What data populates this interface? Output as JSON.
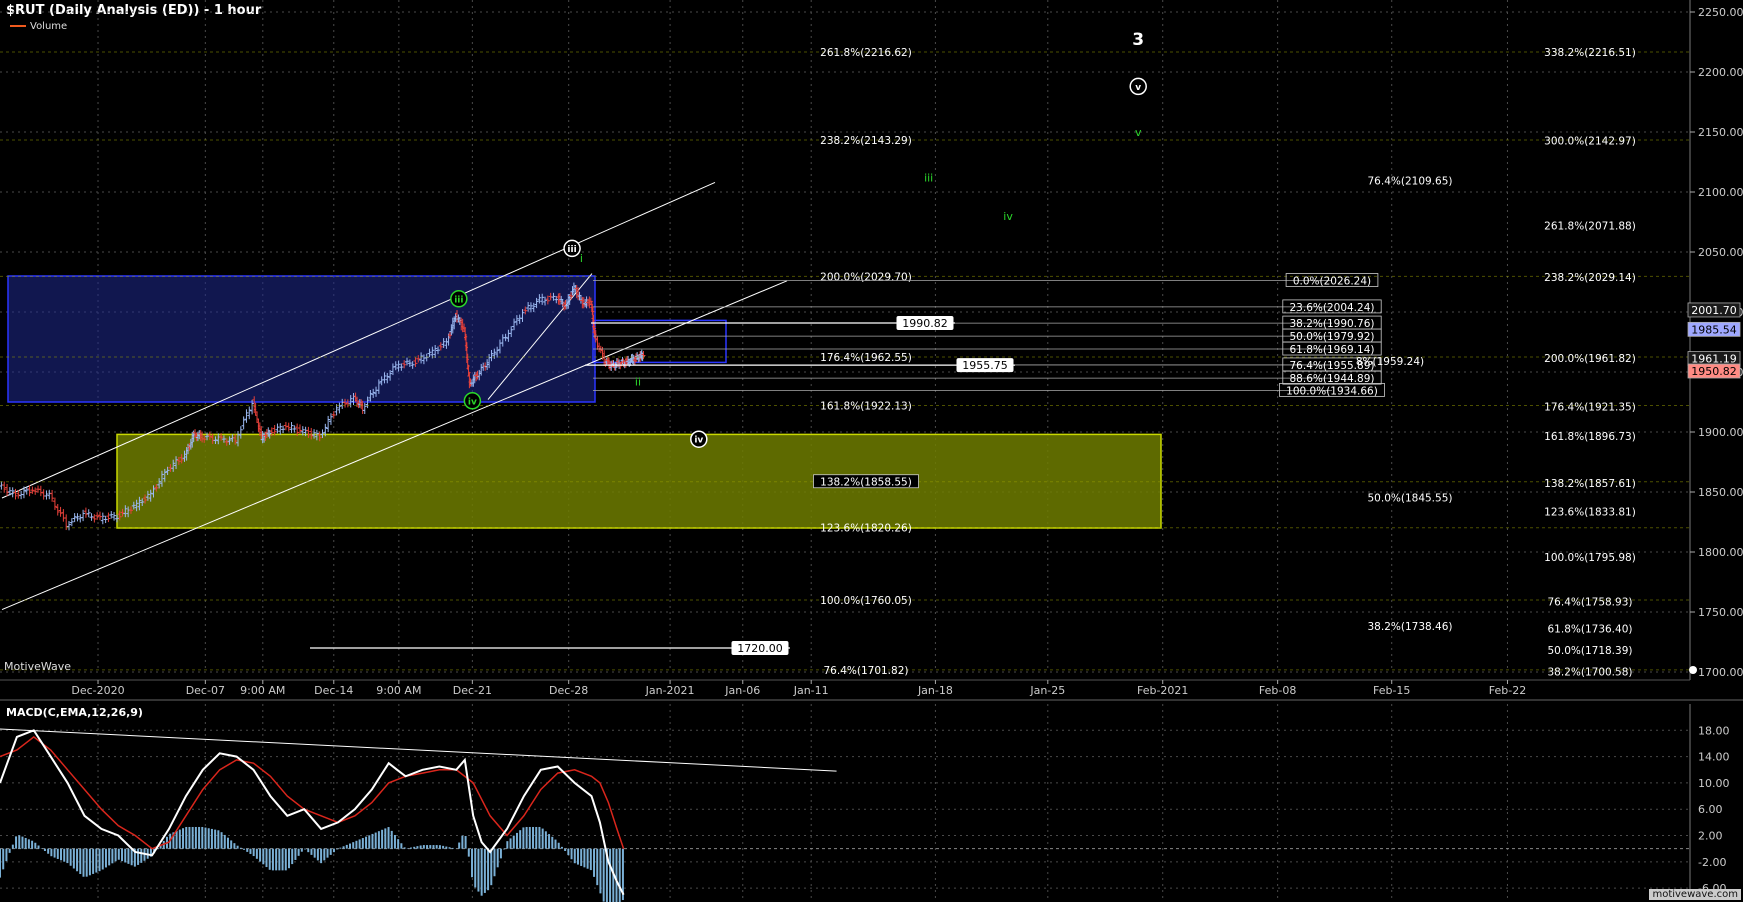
{
  "header": {
    "title": "$RUT (Daily Analysis (ED)) - 1 hour",
    "legend_volume": "Volume",
    "watermark": "MotiveWave",
    "macd_title": "MACD(C,EMA,12,26,9)",
    "logo": "motivewave.com"
  },
  "colors": {
    "background": "#000000",
    "grid": "#4a4a4a",
    "up_bar": "#9bb8f0",
    "down_bar": "#e8413a",
    "blue_box": "#1f2a8f",
    "yellow_box": "#6f7d00",
    "macd_line": "#ffffff",
    "signal_line": "#d9261c",
    "histogram": "#7ab0d6",
    "wave_green": "#2bd82b"
  },
  "chart_data": {
    "type": "candlestick",
    "price_axis": {
      "ylim": [
        1700,
        2260
      ],
      "ticks": [
        "2250.00",
        "2200.00",
        "2150.00",
        "2100.00",
        "2050.00",
        "2000.00",
        "1950.00",
        "1900.00",
        "1850.00",
        "1800.00",
        "1750.00",
        "1700.00"
      ],
      "tick_values": [
        2250,
        2200,
        2150,
        2100,
        2050,
        2000,
        1950,
        1900,
        1850,
        1800,
        1750,
        1700
      ],
      "price_tags": [
        {
          "label": "2001.70",
          "value": 2001.7,
          "style": "dark"
        },
        {
          "label": "1985.54",
          "value": 1985.54,
          "style": "light"
        },
        {
          "label": "1961.19",
          "value": 1961.19,
          "style": "dark"
        },
        {
          "label": "1950.82",
          "value": 1950.82,
          "style": "red"
        }
      ]
    },
    "time_axis": {
      "labels": [
        "Dec-2020",
        "Dec-07",
        "9:00 AM",
        "Dec-14",
        "9:00 AM",
        "Dec-21",
        "Dec-28",
        "Jan-2021",
        "Jan-06",
        "Jan-11",
        "Jan-18",
        "Jan-25",
        "Feb-2021",
        "Feb-08",
        "Feb-15",
        "Feb-22"
      ],
      "positions": [
        0.058,
        0.1215,
        0.1555,
        0.1975,
        0.236,
        0.2795,
        0.3365,
        0.3965,
        0.4395,
        0.48,
        0.5535,
        0.62,
        0.688,
        0.756,
        0.8235,
        0.892
      ]
    },
    "price_path": [
      [
        0,
        1855
      ],
      [
        0.01,
        1848
      ],
      [
        0.02,
        1852
      ],
      [
        0.03,
        1847
      ],
      [
        0.04,
        1823
      ],
      [
        0.05,
        1832
      ],
      [
        0.06,
        1828
      ],
      [
        0.07,
        1830
      ],
      [
        0.08,
        1838
      ],
      [
        0.09,
        1848
      ],
      [
        0.1,
        1870
      ],
      [
        0.11,
        1880
      ],
      [
        0.115,
        1898
      ],
      [
        0.12,
        1896
      ],
      [
        0.13,
        1894
      ],
      [
        0.14,
        1893
      ],
      [
        0.15,
        1925
      ],
      [
        0.155,
        1895
      ],
      [
        0.16,
        1900
      ],
      [
        0.17,
        1905
      ],
      [
        0.18,
        1900
      ],
      [
        0.19,
        1897
      ],
      [
        0.2,
        1920
      ],
      [
        0.21,
        1928
      ],
      [
        0.215,
        1920
      ],
      [
        0.225,
        1940
      ],
      [
        0.235,
        1955
      ],
      [
        0.245,
        1958
      ],
      [
        0.255,
        1965
      ],
      [
        0.265,
        1975
      ],
      [
        0.27,
        1998
      ],
      [
        0.275,
        1985
      ],
      [
        0.278,
        1940
      ],
      [
        0.283,
        1948
      ],
      [
        0.29,
        1960
      ],
      [
        0.3,
        1980
      ],
      [
        0.31,
        2000
      ],
      [
        0.32,
        2010
      ],
      [
        0.33,
        2012
      ],
      [
        0.335,
        2005
      ],
      [
        0.34,
        2020
      ],
      [
        0.345,
        2008
      ],
      [
        0.35,
        2008
      ],
      [
        0.352,
        1980
      ],
      [
        0.358,
        1960
      ],
      [
        0.362,
        1955
      ],
      [
        0.366,
        1957
      ],
      [
        0.37,
        1958
      ],
      [
        0.374,
        1960
      ],
      [
        0.378,
        1962
      ],
      [
        0.381,
        1965
      ]
    ],
    "fib_labels": [
      {
        "label": "261.8%(2216.62)",
        "value": 2216.62,
        "col": "a"
      },
      {
        "label": "238.2%(2143.29)",
        "value": 2143.29,
        "col": "a"
      },
      {
        "label": "200.0%(2029.70)",
        "value": 2029.7,
        "col": "a"
      },
      {
        "label": "176.4%(1962.55)",
        "value": 1962.55,
        "col": "a"
      },
      {
        "label": "161.8%(1922.13)",
        "value": 1922.13,
        "col": "a"
      },
      {
        "label": "138.2%(1858.55)",
        "value": 1858.55,
        "col": "a"
      },
      {
        "label": "123.6%(1820.26)",
        "value": 1820.26,
        "col": "a"
      },
      {
        "label": "100.0%(1760.05)",
        "value": 1760.05,
        "col": "a"
      },
      {
        "label": "76.4%(1701.82)",
        "value": 1701.82,
        "col": "a"
      },
      {
        "label": "76.4%(2109.65)",
        "value": 2109.65,
        "col": "b"
      },
      {
        "label": "50.0%(1845.55)",
        "value": 1845.55,
        "col": "b"
      },
      {
        "label": "38.2%(1738.46)",
        "value": 1738.46,
        "col": "b"
      },
      {
        "label": "0.0%(2026.24)",
        "value": 2026.24,
        "col": "c"
      },
      {
        "label": "23.6%(2004.24)",
        "value": 2004.24,
        "col": "c"
      },
      {
        "label": "38.2%(1990.76)",
        "value": 1990.76,
        "col": "c"
      },
      {
        "label": "50.0%(1979.92)",
        "value": 1979.92,
        "col": "c"
      },
      {
        "label": "61.8%(1969.14)",
        "value": 1969.14,
        "col": "c"
      },
      {
        "label": "76.4%(1955.89)",
        "value": 1955.89,
        "col": "c"
      },
      {
        "label": "88.6%(1944.89)",
        "value": 1944.89,
        "col": "c"
      },
      {
        "label": "100.0%(1934.66)",
        "value": 1934.66,
        "col": "c"
      },
      {
        "label": "8%(1959.24)",
        "value": 1959.24,
        "col": "d"
      },
      {
        "label": "338.2%(2216.51)",
        "value": 2216.51,
        "col": "e"
      },
      {
        "label": "300.0%(2142.97)",
        "value": 2142.97,
        "col": "e"
      },
      {
        "label": "261.8%(2071.88)",
        "value": 2071.88,
        "col": "e"
      },
      {
        "label": "238.2%(2029.14)",
        "value": 2029.14,
        "col": "e"
      },
      {
        "label": "200.0%(1961.82)",
        "value": 1961.82,
        "col": "e"
      },
      {
        "label": "176.4%(1921.35)",
        "value": 1921.35,
        "col": "e"
      },
      {
        "label": "161.8%(1896.73)",
        "value": 1896.73,
        "col": "e"
      },
      {
        "label": "138.2%(1857.61)",
        "value": 1857.61,
        "col": "e"
      },
      {
        "label": "123.6%(1833.81)",
        "value": 1833.81,
        "col": "e"
      },
      {
        "label": "100.0%(1795.98)",
        "value": 1795.98,
        "col": "e"
      },
      {
        "label": "76.4%(1758.93)",
        "value": 1758.93,
        "col": "e"
      },
      {
        "label": "61.8%(1736.40)",
        "value": 1736.4,
        "col": "e"
      },
      {
        "label": "50.0%(1718.39)",
        "value": 1718.39,
        "col": "e"
      },
      {
        "label": "38.2%(1700.58)",
        "value": 1700.58,
        "col": "e"
      }
    ],
    "price_lines": [
      {
        "label": "1990.82",
        "value": 1990.82
      },
      {
        "label": "1955.75",
        "value": 1955.75
      },
      {
        "label": "1720.00",
        "value": 1720.0
      }
    ],
    "wave_labels": [
      {
        "label": "3",
        "style": "plain",
        "color": "white",
        "t": 0.6735,
        "value": 2226
      },
      {
        "label": "v",
        "style": "circle",
        "color": "white",
        "t": 0.6735,
        "value": 2188
      },
      {
        "label": "v",
        "style": "plain",
        "color": "green",
        "t": 0.6735,
        "value": 2150
      },
      {
        "label": "iii",
        "style": "plain",
        "color": "green",
        "t": 0.5495,
        "value": 2112
      },
      {
        "label": "iv",
        "style": "plain",
        "color": "green",
        "t": 0.5965,
        "value": 2080
      },
      {
        "label": "iii",
        "style": "circle",
        "color": "white",
        "t": 0.3385,
        "value": 2053
      },
      {
        "label": "i",
        "style": "plain",
        "color": "green",
        "t": 0.344,
        "value": 2045
      },
      {
        "label": "iii",
        "style": "circle",
        "color": "green",
        "t": 0.2715,
        "value": 2011
      },
      {
        "label": "iv",
        "style": "circle",
        "color": "green",
        "t": 0.2795,
        "value": 1926
      },
      {
        "label": "iv",
        "style": "circle",
        "color": "white",
        "t": 0.4135,
        "value": 1894
      },
      {
        "label": "ii",
        "style": "plain",
        "color": "green",
        "t": 0.3775,
        "value": 1942
      }
    ],
    "macd": {
      "ylim": [
        -7.5,
        22
      ],
      "ticks": [
        "18.00",
        "14.00",
        "10.00",
        "6.00",
        "2.00",
        "-2.00",
        "-6.00"
      ],
      "tick_values": [
        18,
        14,
        10,
        6,
        2,
        -2,
        -6
      ],
      "macd_line": [
        [
          0,
          10
        ],
        [
          0.01,
          17
        ],
        [
          0.02,
          18
        ],
        [
          0.03,
          14
        ],
        [
          0.04,
          10
        ],
        [
          0.05,
          5
        ],
        [
          0.06,
          3
        ],
        [
          0.07,
          2
        ],
        [
          0.08,
          -0.5
        ],
        [
          0.09,
          -1
        ],
        [
          0.1,
          3
        ],
        [
          0.11,
          8
        ],
        [
          0.12,
          12
        ],
        [
          0.13,
          14.5
        ],
        [
          0.14,
          14
        ],
        [
          0.15,
          12
        ],
        [
          0.16,
          8
        ],
        [
          0.17,
          5
        ],
        [
          0.18,
          6
        ],
        [
          0.19,
          3
        ],
        [
          0.2,
          4
        ],
        [
          0.21,
          6
        ],
        [
          0.22,
          9
        ],
        [
          0.23,
          13
        ],
        [
          0.235,
          12
        ],
        [
          0.24,
          11
        ],
        [
          0.25,
          12
        ],
        [
          0.26,
          12.5
        ],
        [
          0.27,
          12
        ],
        [
          0.275,
          13.5
        ],
        [
          0.28,
          5
        ],
        [
          0.285,
          1
        ],
        [
          0.29,
          -0.5
        ],
        [
          0.3,
          3
        ],
        [
          0.31,
          8
        ],
        [
          0.32,
          12
        ],
        [
          0.33,
          12.5
        ],
        [
          0.34,
          10
        ],
        [
          0.35,
          8
        ],
        [
          0.355,
          4
        ],
        [
          0.36,
          -2
        ],
        [
          0.365,
          -5
        ],
        [
          0.369,
          -7
        ]
      ],
      "signal_line": [
        [
          0,
          14
        ],
        [
          0.01,
          15
        ],
        [
          0.02,
          17
        ],
        [
          0.03,
          15
        ],
        [
          0.04,
          12
        ],
        [
          0.05,
          9
        ],
        [
          0.06,
          6
        ],
        [
          0.07,
          3.5
        ],
        [
          0.08,
          2
        ],
        [
          0.09,
          0
        ],
        [
          0.1,
          1
        ],
        [
          0.11,
          5
        ],
        [
          0.12,
          9
        ],
        [
          0.13,
          12
        ],
        [
          0.14,
          13.5
        ],
        [
          0.15,
          13
        ],
        [
          0.16,
          11
        ],
        [
          0.17,
          8
        ],
        [
          0.18,
          6
        ],
        [
          0.19,
          5
        ],
        [
          0.2,
          4
        ],
        [
          0.21,
          5
        ],
        [
          0.22,
          7
        ],
        [
          0.23,
          10
        ],
        [
          0.24,
          11
        ],
        [
          0.25,
          11.5
        ],
        [
          0.26,
          12
        ],
        [
          0.27,
          12
        ],
        [
          0.28,
          10
        ],
        [
          0.29,
          5
        ],
        [
          0.3,
          2
        ],
        [
          0.31,
          5
        ],
        [
          0.32,
          9
        ],
        [
          0.33,
          11.5
        ],
        [
          0.34,
          12
        ],
        [
          0.35,
          11
        ],
        [
          0.355,
          10
        ],
        [
          0.36,
          7
        ],
        [
          0.365,
          3
        ],
        [
          0.369,
          0
        ]
      ],
      "trend_line": [
        [
          0.0,
          18.2
        ],
        [
          0.495,
          11.8
        ]
      ]
    }
  }
}
